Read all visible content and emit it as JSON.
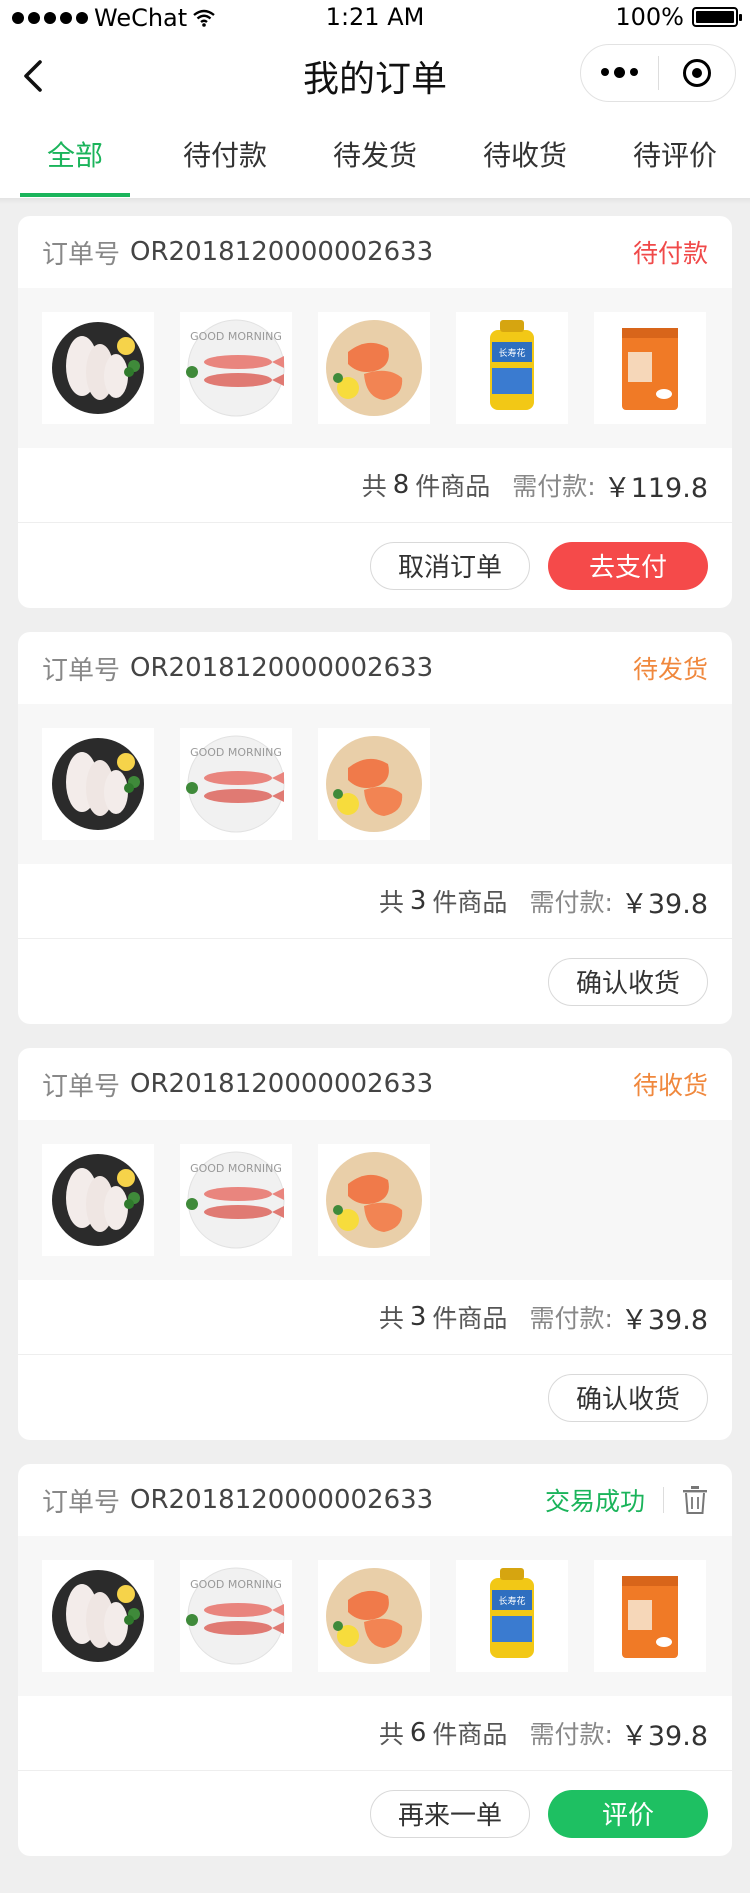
{
  "status_bar": {
    "carrier": "WeChat",
    "time": "1:21 AM",
    "battery": "100%"
  },
  "nav": {
    "title": "我的订单"
  },
  "tabs": [
    "全部",
    "待付款",
    "待发货",
    "待收货",
    "待评价"
  ],
  "order_label": "订单号",
  "summary_text": {
    "prefix": "共",
    "suffix": "件商品",
    "need_label": "需付款:"
  },
  "orders": [
    {
      "order_no": "OR2018120000002633",
      "status": "待付款",
      "count": "8",
      "price": "￥119.8",
      "buttons": [
        "取消订单",
        "去支付"
      ]
    },
    {
      "order_no": "OR2018120000002633",
      "status": "待发货",
      "count": "3",
      "price": "￥39.8",
      "buttons": [
        "确认收货"
      ]
    },
    {
      "order_no": "OR2018120000002633",
      "status": "待收货",
      "count": "3",
      "price": "￥39.8",
      "buttons": [
        "确认收货"
      ]
    },
    {
      "order_no": "OR2018120000002633",
      "status": "交易成功",
      "count": "6",
      "price": "￥39.8",
      "buttons": [
        "再来一单",
        "评价"
      ]
    }
  ],
  "colors": {
    "accent_green": "#1bb45b",
    "pay_red": "#f54a4a",
    "status_orange": "#f0883d"
  }
}
